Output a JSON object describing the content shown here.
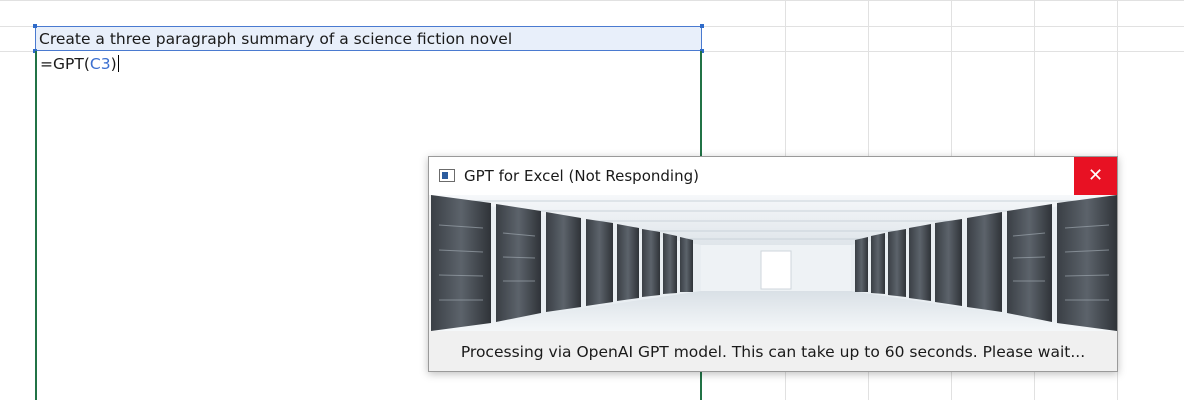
{
  "sheet": {
    "prompt_cell": "Create a three paragraph summary of a science fiction novel",
    "formula_cell": {
      "prefix": "=GPT(",
      "ref": "C3",
      "suffix": ")"
    }
  },
  "dialog": {
    "title": "GPT for Excel (Not Responding)",
    "close_symbol": "✕",
    "image_subject": "data-center-server-hallway",
    "status_text": "Processing via OpenAI GPT model. This can take up to 60 seconds. Please wait..."
  },
  "colors": {
    "selection_border": "#4a7ad0",
    "active_column_border": "#217346",
    "close_button": "#e81123",
    "grid_line": "#e1e1e1",
    "cell_reference": "#3b6fd0"
  }
}
